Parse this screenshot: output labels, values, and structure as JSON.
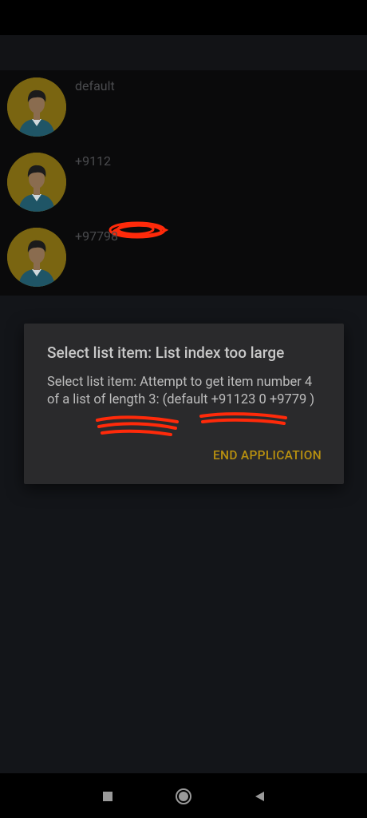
{
  "list": {
    "items": [
      {
        "text": "default"
      },
      {
        "text": "+9112"
      },
      {
        "text": "+97798"
      }
    ]
  },
  "dialog": {
    "title": "Select list item: List index too large",
    "message": "Select list item: Attempt to get item number 4 of a list of length 3: (default +91123 0 +9779 )",
    "button_label": "END APPLICATION"
  },
  "colors": {
    "avatar_bg": "#7a6511",
    "accent": "#b8900f",
    "dialog_bg": "#2a2a2c",
    "redaction": "#ff2a0a"
  },
  "icons": {
    "avatar": "person-avatar-icon",
    "nav_recents": "square-icon",
    "nav_home": "circle-icon",
    "nav_back": "triangle-back-icon"
  }
}
